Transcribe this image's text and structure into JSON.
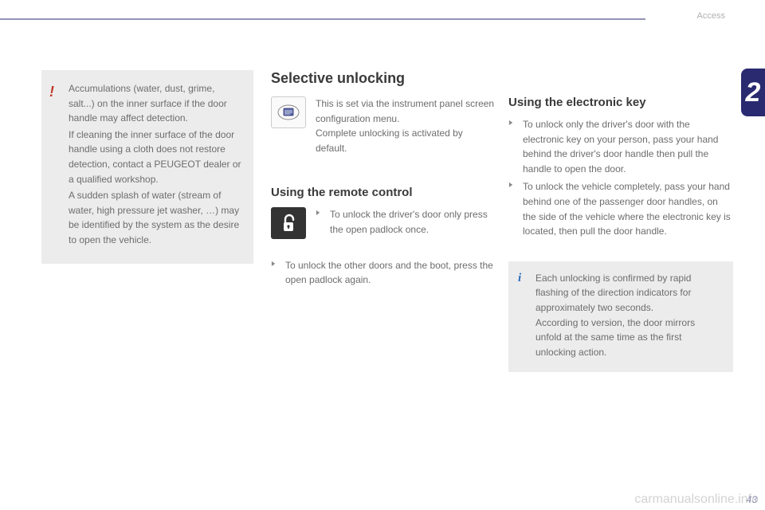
{
  "header": {
    "category": "Access"
  },
  "sidetab": {
    "chapter": "2"
  },
  "pagenum": "43",
  "watermark": "carmanualsonline.info",
  "warning": {
    "p1": "Accumulations (water, dust, grime, salt...) on the inner surface if the door handle may affect detection.",
    "p2": "If cleaning the inner surface of the door handle using a cloth does not restore detection, contact a PEUGEOT dealer or a qualified workshop.",
    "p3": "A sudden splash of water (stream of water, high pressure jet washer, …) may be identified by the system as the desire to open the vehicle."
  },
  "main": {
    "title": "Selective unlocking",
    "intro": {
      "l1": "This is set via the instrument panel screen configuration menu.",
      "l2": "Complete unlocking is activated by default."
    },
    "remote": {
      "heading": "Using the remote control",
      "b1": "To unlock the driver's door only press the open padlock once.",
      "b2": "To unlock the other doors and the boot, press the open padlock again."
    },
    "ekey": {
      "heading": "Using the electronic key",
      "b1": "To unlock only the driver's door with the electronic key on your person, pass your hand behind the driver's door handle then pull the handle to open the door.",
      "b2": "To unlock the vehicle completely, pass your hand behind one of the passenger door handles, on the side of the vehicle where the electronic key is located, then pull the door handle."
    },
    "info": {
      "l1": "Each unlocking is confirmed by rapid flashing of the direction indicators for approximately two seconds.",
      "l2": "According to version, the door mirrors unfold at the same time as the first unlocking action."
    }
  }
}
